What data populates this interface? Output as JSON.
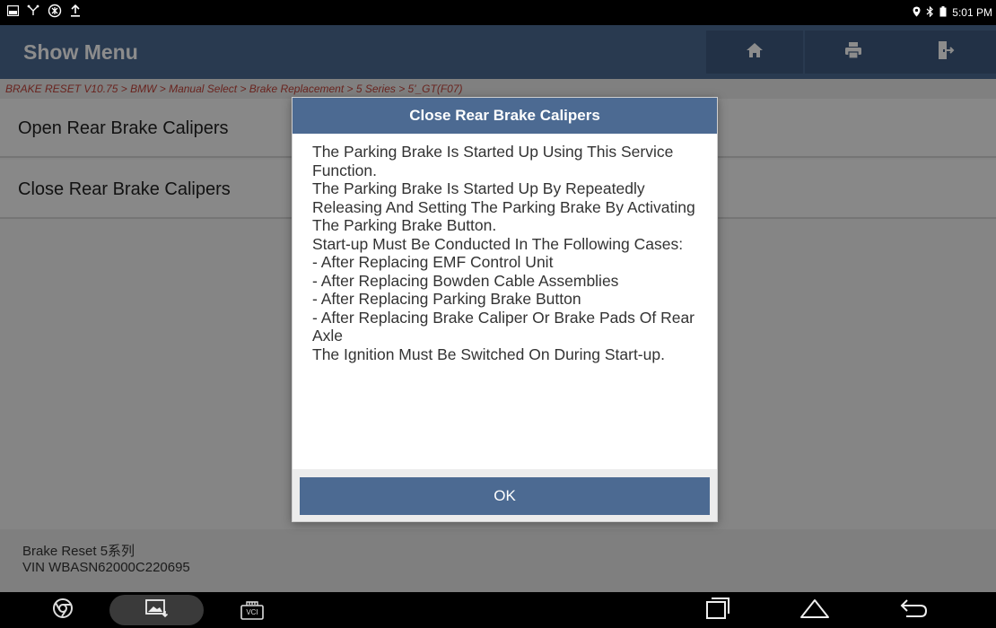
{
  "status_bar": {
    "time": "5:01 PM",
    "left_icons": [
      "screenshot-icon",
      "usb-debug-icon",
      "vci-connect-icon",
      "upload-icon"
    ],
    "right_icons": [
      "location-icon",
      "bluetooth-icon",
      "battery-icon"
    ]
  },
  "header": {
    "title": "Show Menu",
    "buttons": [
      "home-icon",
      "print-icon",
      "exit-icon"
    ]
  },
  "breadcrumb": "BRAKE RESET V10.75 > BMW > Manual Select > Brake Replacement > 5 Series > 5'_GT(F07)",
  "menu": {
    "items": [
      {
        "label": "Open Rear Brake Calipers"
      },
      {
        "label": "Close Rear Brake Calipers"
      }
    ]
  },
  "dialog": {
    "title": "Close Rear Brake Calipers",
    "body": "The Parking Brake Is Started Up Using This Service Function.\nThe Parking Brake Is Started Up By Repeatedly Releasing And Setting The Parking Brake By Activating The Parking Brake Button.\nStart-up Must Be Conducted In The Following Cases:\n- After Replacing EMF Control Unit\n- After Replacing Bowden Cable Assemblies\n- After Replacing Parking Brake Button\n- After Replacing Brake Caliper Or Brake Pads Of Rear Axle\nThe Ignition Must Be Switched On During Start-up.",
    "ok_label": "OK"
  },
  "vehicle_info": {
    "line1": "Brake Reset 5系列",
    "line2": "VIN WBASN62000C220695"
  },
  "nav_bar": {
    "vci_label": "VCI",
    "icons": [
      "browser-icon",
      "gallery-icon",
      "vci-icon",
      "recent-apps-icon",
      "home-nav-icon",
      "back-icon"
    ]
  },
  "colors": {
    "header_bg": "#4c6a92",
    "breadcrumb_text": "#c0433a",
    "button_bg": "#4c6a92"
  }
}
